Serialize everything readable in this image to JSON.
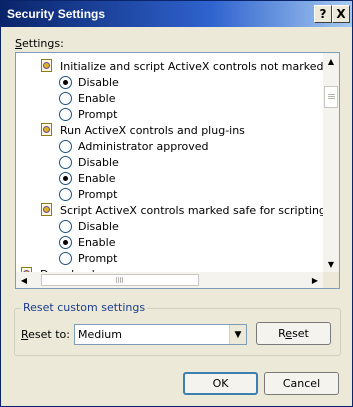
{
  "window": {
    "title": "Security Settings",
    "help_glyph": "?",
    "close_glyph": "X"
  },
  "settings_label": "Settings:",
  "settings_list": [
    {
      "type": "category",
      "label": "Initialize and script ActiveX controls not marked as safe"
    },
    {
      "type": "option",
      "label": "Disable",
      "checked": true
    },
    {
      "type": "option",
      "label": "Enable",
      "checked": false
    },
    {
      "type": "option",
      "label": "Prompt",
      "checked": false
    },
    {
      "type": "category",
      "label": "Run ActiveX controls and plug-ins"
    },
    {
      "type": "option",
      "label": "Administrator approved",
      "checked": false
    },
    {
      "type": "option",
      "label": "Disable",
      "checked": false
    },
    {
      "type": "option",
      "label": "Enable",
      "checked": true
    },
    {
      "type": "option",
      "label": "Prompt",
      "checked": false
    },
    {
      "type": "category",
      "label": "Script ActiveX controls marked safe for scripting"
    },
    {
      "type": "option",
      "label": "Disable",
      "checked": false
    },
    {
      "type": "option",
      "label": "Enable",
      "checked": true
    },
    {
      "type": "option",
      "label": "Prompt",
      "checked": false
    },
    {
      "type": "category",
      "label": "Downloads"
    }
  ],
  "reset_group": {
    "legend": "Reset custom settings",
    "reset_to_label": "Reset to:",
    "reset_to_value": "Medium",
    "reset_button": "Reset"
  },
  "buttons": {
    "ok": "OK",
    "cancel": "Cancel"
  },
  "colors": {
    "title_bar": "#0a246a",
    "dialog_bg": "#ece9d8",
    "accent_border": "#3c7fb1"
  }
}
